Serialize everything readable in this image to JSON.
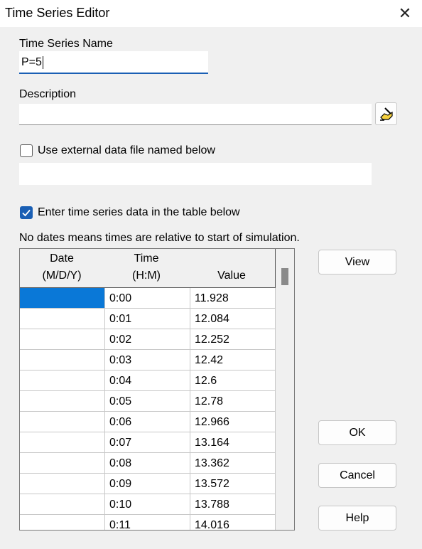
{
  "window": {
    "title": "Time Series Editor",
    "close_glyph": "✕"
  },
  "form": {
    "name_label": "Time Series Name",
    "name_value": "P=5",
    "description_label": "Description",
    "description_value": "",
    "external_file_label": "Use external data file named below",
    "external_file_checked": false,
    "external_file_value": "",
    "table_option_label": "Enter time series data in the table below",
    "table_option_checked": true,
    "note": "No dates means times are relative to start of simulation."
  },
  "table": {
    "headers": {
      "date_line1": "Date",
      "date_line2": "(M/D/Y)",
      "time_line1": "Time",
      "time_line2": "(H:M)",
      "value": "Value"
    },
    "rows": [
      {
        "date": "",
        "time": "0:00",
        "value": "11.928"
      },
      {
        "date": "",
        "time": "0:01",
        "value": "12.084"
      },
      {
        "date": "",
        "time": "0:02",
        "value": "12.252"
      },
      {
        "date": "",
        "time": "0:03",
        "value": "12.42"
      },
      {
        "date": "",
        "time": "0:04",
        "value": "12.6"
      },
      {
        "date": "",
        "time": "0:05",
        "value": "12.78"
      },
      {
        "date": "",
        "time": "0:06",
        "value": "12.966"
      },
      {
        "date": "",
        "time": "0:07",
        "value": "13.164"
      },
      {
        "date": "",
        "time": "0:08",
        "value": "13.362"
      },
      {
        "date": "",
        "time": "0:09",
        "value": "13.572"
      },
      {
        "date": "",
        "time": "0:10",
        "value": "13.788"
      },
      {
        "date": "",
        "time": "0:11",
        "value": "14.016"
      }
    ]
  },
  "buttons": {
    "view": "View",
    "ok": "OK",
    "cancel": "Cancel",
    "help": "Help"
  },
  "colors": {
    "accent": "#1a5fb4",
    "selection": "#0a78d7"
  },
  "icons": {
    "description_editor": "hand-pencil-icon",
    "checkmark": "checkmark-icon"
  }
}
